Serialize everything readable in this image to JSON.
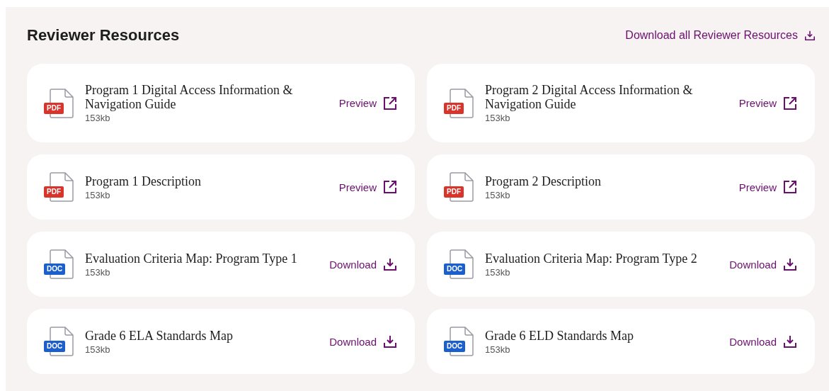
{
  "title": "Reviewer Resources",
  "download_all": {
    "label": "Download all Reviewer Resources"
  },
  "resources": [
    {
      "kind": "pdf",
      "badge": "PDF",
      "name": "Program 1 Digital Access Information & Navigation Guide",
      "size": "153kb",
      "action": {
        "kind": "preview",
        "label": "Preview"
      }
    },
    {
      "kind": "pdf",
      "badge": "PDF",
      "name": "Program 2 Digital Access Information & Navigation Guide",
      "size": "153kb",
      "action": {
        "kind": "preview",
        "label": "Preview"
      }
    },
    {
      "kind": "pdf",
      "badge": "PDF",
      "name": "Program 1 Description",
      "size": "153kb",
      "action": {
        "kind": "preview",
        "label": "Preview"
      }
    },
    {
      "kind": "pdf",
      "badge": "PDF",
      "name": "Program 2 Description",
      "size": "153kb",
      "action": {
        "kind": "preview",
        "label": "Preview"
      }
    },
    {
      "kind": "doc",
      "badge": "DOC",
      "name": "Evaluation Criteria Map: Program Type 1",
      "size": "153kb",
      "action": {
        "kind": "download",
        "label": "Download"
      }
    },
    {
      "kind": "doc",
      "badge": "DOC",
      "name": "Evaluation Criteria Map: Program Type 2",
      "size": "153kb",
      "action": {
        "kind": "download",
        "label": "Download"
      }
    },
    {
      "kind": "doc",
      "badge": "DOC",
      "name": "Grade 6 ELA Standards Map",
      "size": "153kb",
      "action": {
        "kind": "download",
        "label": "Download"
      }
    },
    {
      "kind": "doc",
      "badge": "DOC",
      "name": "Grade 6 ELD Standards Map",
      "size": "153kb",
      "action": {
        "kind": "download",
        "label": "Download"
      }
    }
  ]
}
